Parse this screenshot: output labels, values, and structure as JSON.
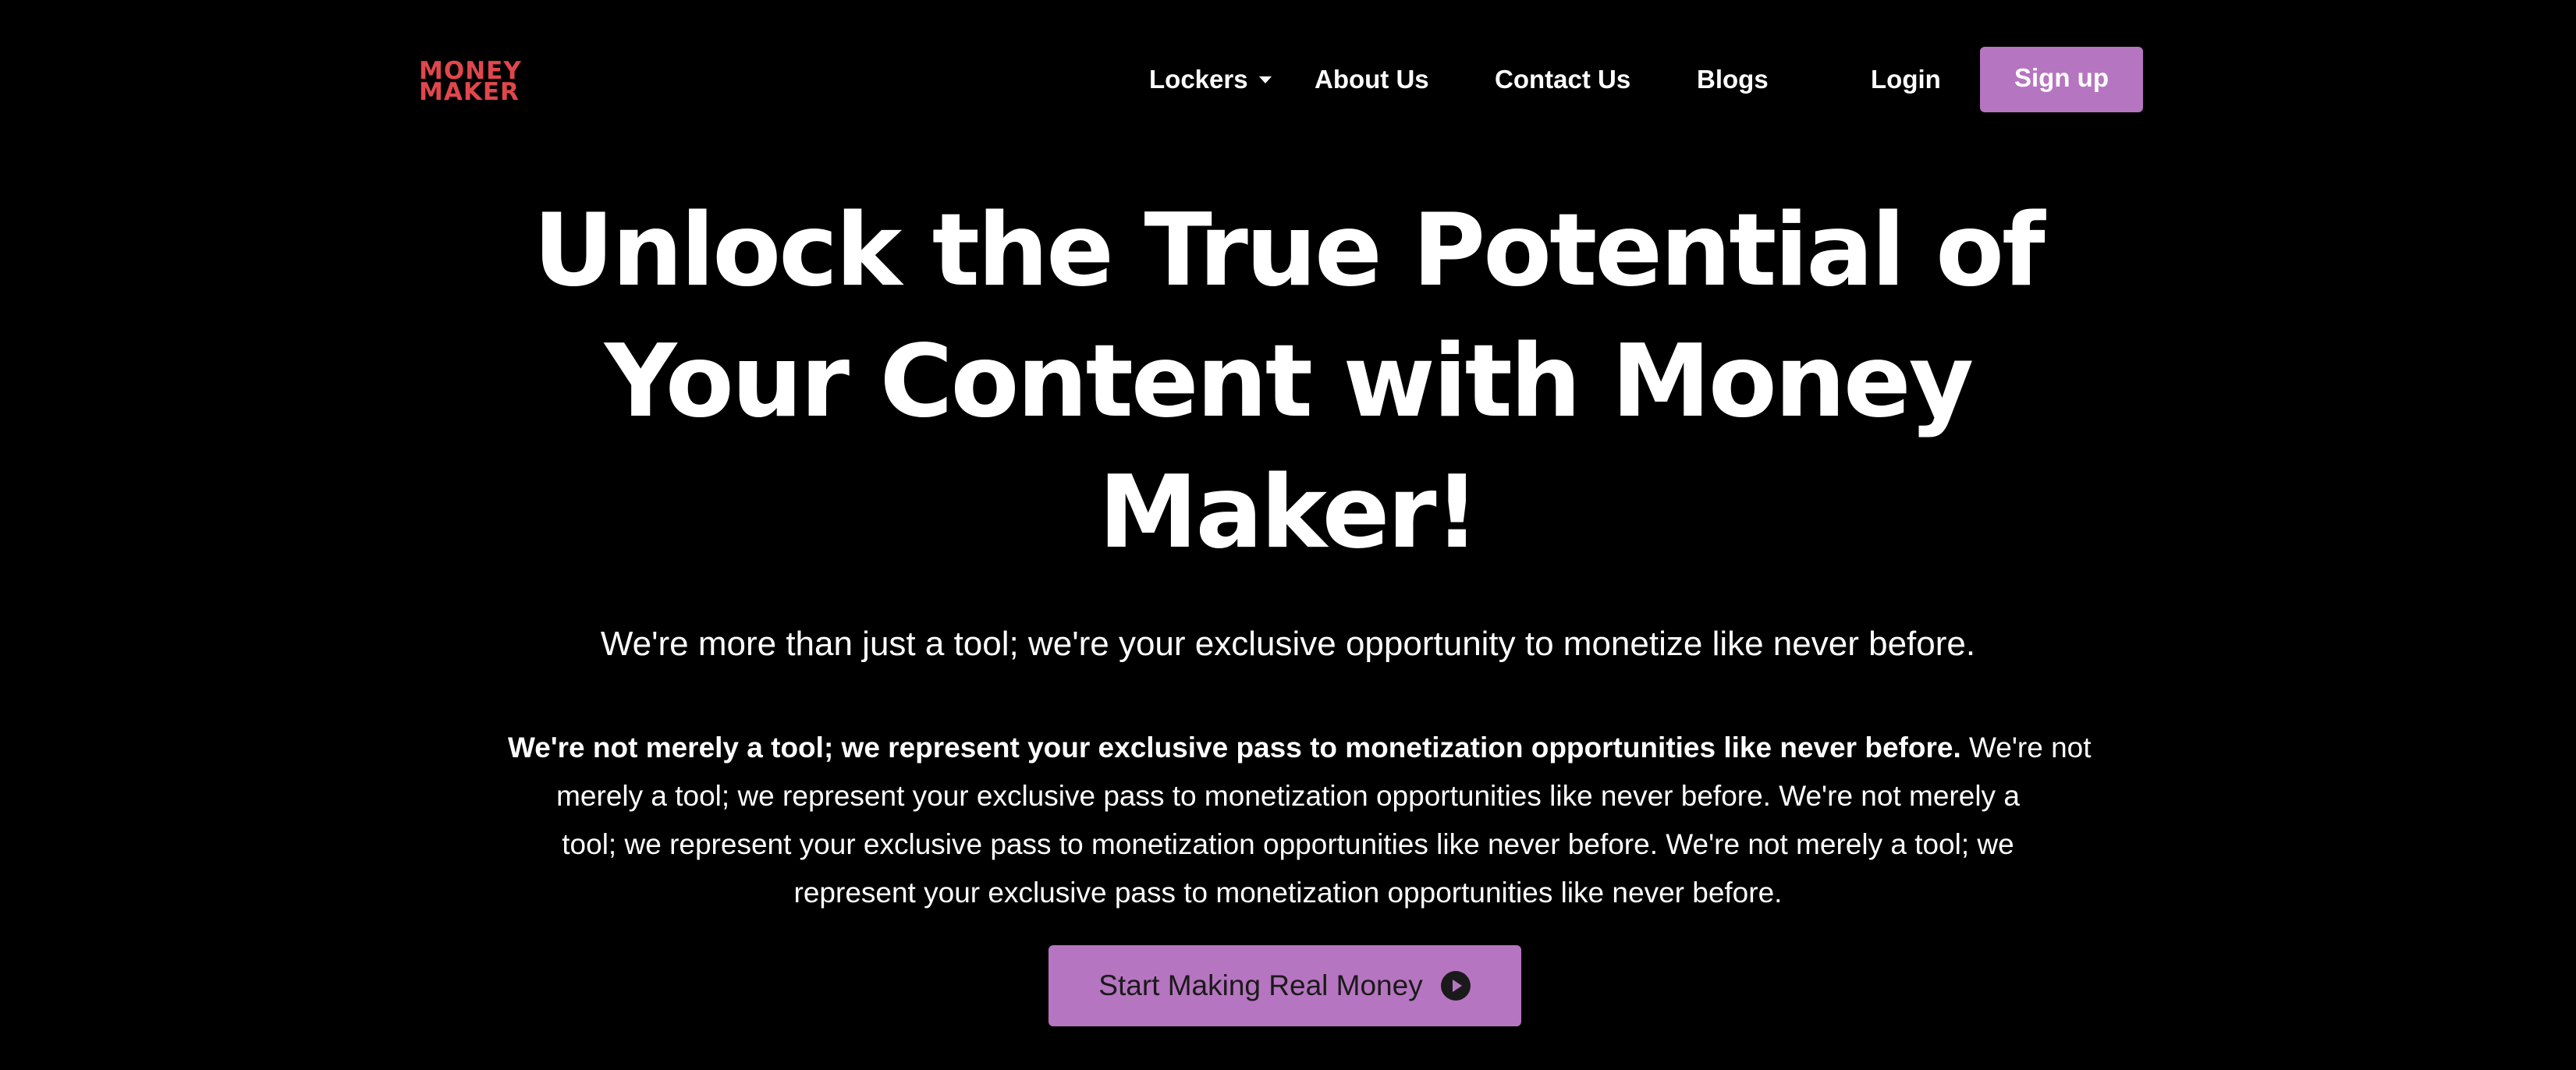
{
  "brand": {
    "logo_line1": "MONEY",
    "logo_line2": "MAKER"
  },
  "nav": {
    "lockers": "Lockers",
    "about": "About Us",
    "contact": "Contact Us",
    "blogs": "Blogs",
    "login": "Login",
    "signup": "Sign up"
  },
  "hero": {
    "title_line1": "Unlock the True Potential of",
    "title_line2": "Your Content with Money",
    "title_line3": "Maker!",
    "subtitle": "We're more than just a tool; we're your exclusive opportunity to monetize like never before.",
    "body_bold": "We're not merely a tool; we represent your exclusive pass to monetization opportunities like never before.",
    "body_line1_rest": " We're not",
    "body_line2": "merely a tool; we represent your exclusive pass to monetization opportunities like never before. We're not merely a",
    "body_line3": "tool; we represent your exclusive pass to monetization opportunities like never before. We're not merely a tool; we",
    "body_line4": "represent your exclusive pass to monetization opportunities like never before.",
    "cta_label": "Start Making Real Money"
  },
  "icons": {
    "lockers_caret": "chevron-down-icon",
    "cta": "play-circle-icon"
  },
  "colors": {
    "background": "#000000",
    "text": "#ffffff",
    "accent": "#b675c0",
    "logo": "#e0474c",
    "cta_text": "#1a1a1a"
  }
}
